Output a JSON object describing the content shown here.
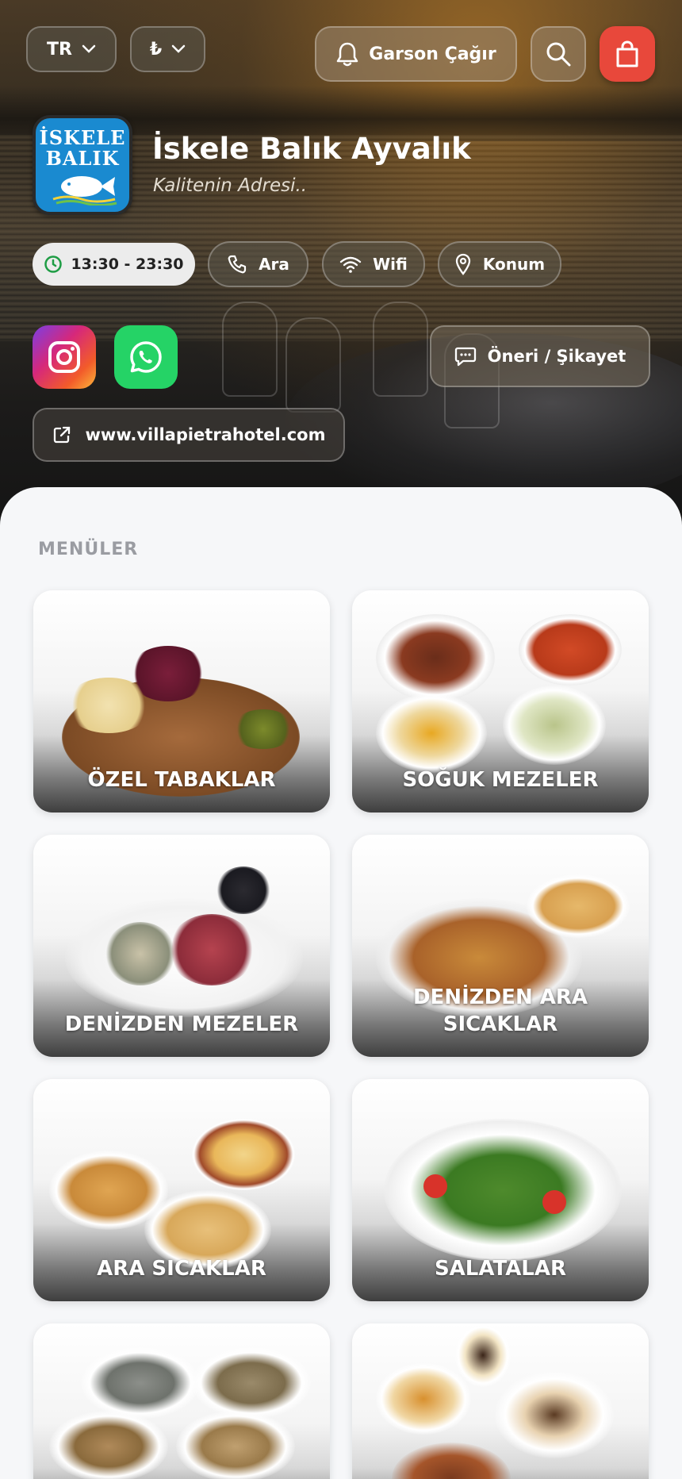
{
  "header": {
    "language": "TR",
    "currency": "₺",
    "call_waiter_label": "Garson Çağır"
  },
  "restaurant": {
    "logo_line1": "İSKELE",
    "logo_line2": "BALIK",
    "name": "İskele Balık Ayvalık",
    "tagline": "Kalitenin Adresi.."
  },
  "info": {
    "hours": "13:30 - 23:30",
    "call_label": "Ara",
    "wifi_label": "Wifi",
    "location_label": "Konum"
  },
  "actions": {
    "feedback_label": "Öneri / Şikayet",
    "website": "www.villapietrahotel.com"
  },
  "colors": {
    "cart": "#e8483b",
    "whatsapp": "#25d366",
    "hours_pill_bg": "#ececec",
    "hours_icon": "#1f9d45"
  },
  "menus": {
    "title": "MENÜLER",
    "items": [
      {
        "label": "ÖZEL TABAKLAR"
      },
      {
        "label": "SOĞUK MEZELER"
      },
      {
        "label": "DENİZDEN MEZELER"
      },
      {
        "label": "DENİZDEN ARA SICAKLAR"
      },
      {
        "label": "ARA SICAKLAR"
      },
      {
        "label": "SALATALAR"
      },
      {
        "label": ""
      },
      {
        "label": ""
      }
    ]
  }
}
